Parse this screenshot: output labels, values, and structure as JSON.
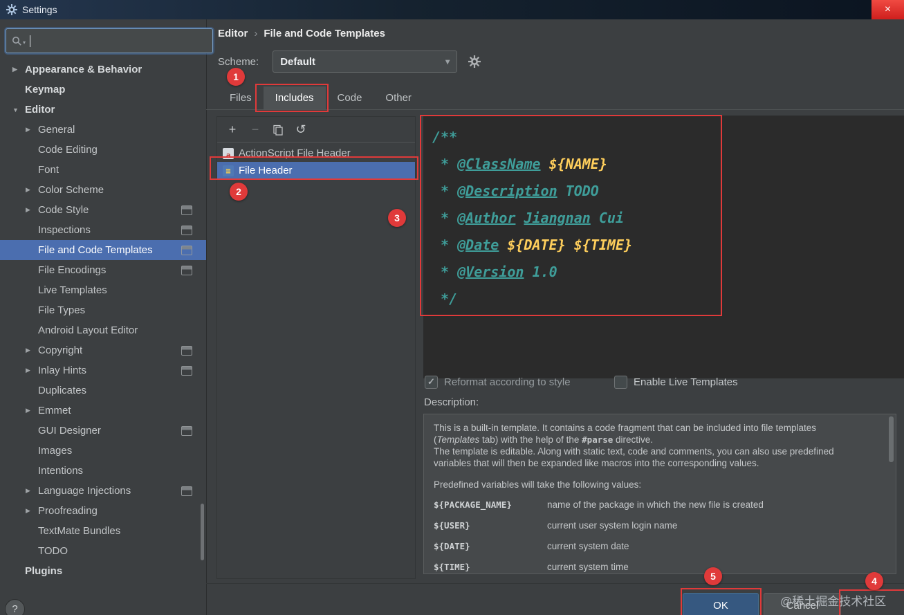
{
  "window": {
    "title": "Settings"
  },
  "icons": {
    "close": "×",
    "chevron_collapsed": "▶",
    "chevron_expanded": "▼",
    "dropdown_caret": "▾",
    "add": "+",
    "remove": "−",
    "reset": "↺",
    "check": "✓",
    "breadcrumb_sep": "›"
  },
  "colors": {
    "selection_blue": "#4b6eaf",
    "annotation_red": "#e03a3a",
    "editor_background": "#2b2b2b",
    "doc_comment_teal": "#3f9e9a",
    "template_variable_yellow": "#ffcf5c",
    "ok_button_blue": "#365880"
  },
  "sidebar": {
    "search": {
      "value": "",
      "placeholder": ""
    },
    "items": [
      {
        "label": "Appearance & Behavior",
        "level": 0,
        "arrow": "collapsed"
      },
      {
        "label": "Keymap",
        "level": 0
      },
      {
        "label": "Editor",
        "level": 0,
        "arrow": "expanded"
      },
      {
        "label": "General",
        "level": 1,
        "arrow": "collapsed"
      },
      {
        "label": "Code Editing",
        "level": 1
      },
      {
        "label": "Font",
        "level": 1
      },
      {
        "label": "Color Scheme",
        "level": 1,
        "arrow": "collapsed"
      },
      {
        "label": "Code Style",
        "level": 1,
        "arrow": "collapsed",
        "badge": true
      },
      {
        "label": "Inspections",
        "level": 1,
        "badge": true
      },
      {
        "label": "File and Code Templates",
        "level": 1,
        "badge": true,
        "selected": true
      },
      {
        "label": "File Encodings",
        "level": 1,
        "badge": true
      },
      {
        "label": "Live Templates",
        "level": 1
      },
      {
        "label": "File Types",
        "level": 1
      },
      {
        "label": "Android Layout Editor",
        "level": 1
      },
      {
        "label": "Copyright",
        "level": 1,
        "arrow": "collapsed",
        "badge": true
      },
      {
        "label": "Inlay Hints",
        "level": 1,
        "arrow": "collapsed",
        "badge": true
      },
      {
        "label": "Duplicates",
        "level": 1
      },
      {
        "label": "Emmet",
        "level": 1,
        "arrow": "collapsed"
      },
      {
        "label": "GUI Designer",
        "level": 1,
        "badge": true
      },
      {
        "label": "Images",
        "level": 1
      },
      {
        "label": "Intentions",
        "level": 1
      },
      {
        "label": "Language Injections",
        "level": 1,
        "arrow": "collapsed",
        "badge": true
      },
      {
        "label": "Proofreading",
        "level": 1,
        "arrow": "collapsed"
      },
      {
        "label": "TextMate Bundles",
        "level": 1
      },
      {
        "label": "TODO",
        "level": 1
      },
      {
        "label": "Plugins",
        "level": 0
      }
    ]
  },
  "header": {
    "breadcrumb_parent": "Editor",
    "breadcrumb_current": "File and Code Templates",
    "scheme_label": "Scheme:",
    "scheme_value": "Default"
  },
  "tabs": [
    {
      "label": "Files",
      "selected": false
    },
    {
      "label": "Includes",
      "selected": true
    },
    {
      "label": "Code",
      "selected": false
    },
    {
      "label": "Other",
      "selected": false
    }
  ],
  "template_list": [
    {
      "label": "ActionScript File Header",
      "selected": false,
      "icon": "actionscript-file-icon"
    },
    {
      "label": "File Header",
      "selected": true,
      "icon": "file-header-icon"
    }
  ],
  "editor": {
    "lines": [
      [
        {
          "t": "/**",
          "s": "doc"
        }
      ],
      [
        {
          "t": " * ",
          "s": "doc"
        },
        {
          "t": "@ClassName",
          "s": "tag"
        },
        {
          "t": " ",
          "s": "doc"
        },
        {
          "t": "${NAME}",
          "s": "var"
        }
      ],
      [
        {
          "t": " * ",
          "s": "doc"
        },
        {
          "t": "@Description",
          "s": "tag"
        },
        {
          "t": " TODO",
          "s": "doc"
        }
      ],
      [
        {
          "t": " * ",
          "s": "doc"
        },
        {
          "t": "@Author",
          "s": "tag"
        },
        {
          "t": " ",
          "s": "doc"
        },
        {
          "t": "Jiangnan",
          "s": "tag"
        },
        {
          "t": " Cui",
          "s": "doc"
        }
      ],
      [
        {
          "t": " * ",
          "s": "doc"
        },
        {
          "t": "@Date",
          "s": "tag"
        },
        {
          "t": " ",
          "s": "doc"
        },
        {
          "t": "${DATE}",
          "s": "var"
        },
        {
          "t": " ",
          "s": "doc"
        },
        {
          "t": "${TIME}",
          "s": "var"
        }
      ],
      [
        {
          "t": " * ",
          "s": "doc"
        },
        {
          "t": "@Version",
          "s": "tag"
        },
        {
          "t": " 1.0",
          "s": "doc"
        }
      ],
      [
        {
          "t": " */",
          "s": "doc"
        }
      ]
    ]
  },
  "options": {
    "reformat_label": "Reformat according to style",
    "reformat_checked": true,
    "live_templates_label": "Enable Live Templates",
    "live_templates_checked": false
  },
  "description": {
    "label": "Description:",
    "paragraphs": [
      [
        {
          "t": "This is a built-in template. It contains a code fragment that can be included into file templates",
          "s": "plain"
        }
      ],
      [
        {
          "t": "(",
          "s": "plain"
        },
        {
          "t": "Templates",
          "s": "italic"
        },
        {
          "t": " tab) with the help of the ",
          "s": "plain"
        },
        {
          "t": "#parse",
          "s": "mono"
        },
        {
          "t": " directive.",
          "s": "plain"
        }
      ],
      [
        {
          "t": "The template is editable. Along with static text, code and comments, you can also use predefined",
          "s": "plain"
        }
      ],
      [
        {
          "t": "variables that will then be expanded like macros into the corresponding values.",
          "s": "plain"
        }
      ]
    ],
    "variables_intro": "Predefined variables will take the following values:",
    "variables": [
      {
        "name": "${PACKAGE_NAME}",
        "desc": "name of the package in which the new file is created"
      },
      {
        "name": "${USER}",
        "desc": "current user system login name"
      },
      {
        "name": "${DATE}",
        "desc": "current system date"
      },
      {
        "name": "${TIME}",
        "desc": "current system time"
      }
    ]
  },
  "footer": {
    "ok": "OK",
    "cancel": "Cancel",
    "help": "?"
  },
  "annotations": {
    "circle1": "1",
    "circle2": "2",
    "circle3": "3",
    "circle4": "4",
    "circle5": "5"
  },
  "watermark": "@稀土掘金技术社区"
}
